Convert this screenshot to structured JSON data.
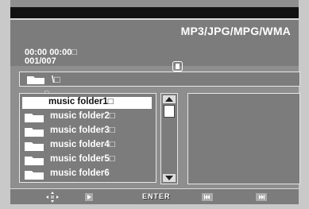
{
  "header": {
    "format": "MP3/JPG/MPG/WMA",
    "time": "00:00  00:00□",
    "track": "001/007"
  },
  "path": {
    "text": "\\□"
  },
  "list": {
    "marker": "□",
    "items": [
      {
        "label": "music folder1□",
        "selected": true
      },
      {
        "label": "music folder2□"
      },
      {
        "label": "music folder3□"
      },
      {
        "label": "music folder4□"
      },
      {
        "label": "music folder5□"
      },
      {
        "label": "music folder6"
      }
    ]
  },
  "controls": {
    "enter": "ENTER"
  },
  "icons": [
    "folder-icon",
    "stop-icon",
    "navigation-arrows-icon",
    "play-icon",
    "previous-track-icon",
    "next-track-icon",
    "scroll-up-arrow-icon",
    "scroll-down-arrow-icon"
  ]
}
